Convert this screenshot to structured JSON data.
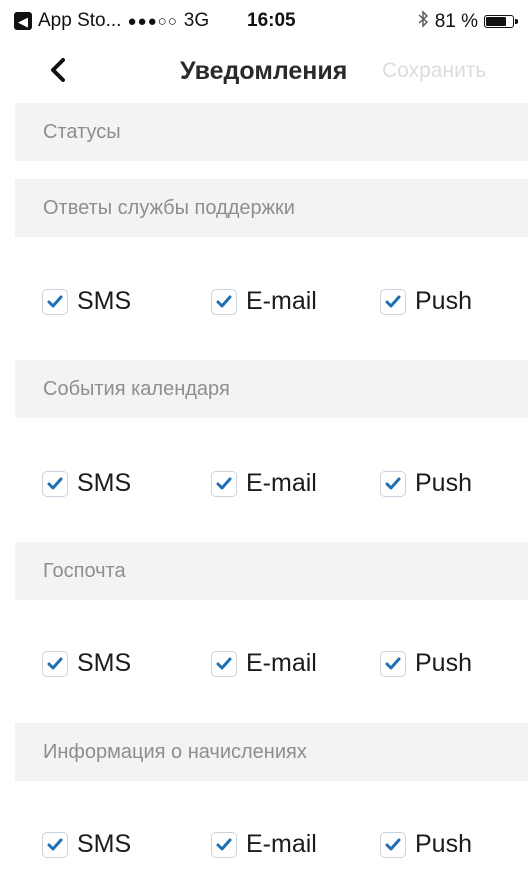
{
  "status_bar": {
    "back_app": "App Sto...",
    "signal": "●●●○○",
    "network": "3G",
    "time": "16:05",
    "battery_text": "81 %",
    "battery_level": 0.81
  },
  "navbar": {
    "title": "Уведомления",
    "save_label": "Сохранить"
  },
  "sections": [
    {
      "header": "Статусы"
    },
    {
      "header": "Ответы службы поддержки",
      "options": [
        {
          "label": "SMS",
          "checked": true
        },
        {
          "label": "E-mail",
          "checked": true
        },
        {
          "label": "Push",
          "checked": true
        }
      ]
    },
    {
      "header": "События календаря",
      "options": [
        {
          "label": "SMS",
          "checked": true
        },
        {
          "label": "E-mail",
          "checked": true
        },
        {
          "label": "Push",
          "checked": true
        }
      ]
    },
    {
      "header": "Госпочта",
      "options": [
        {
          "label": "SMS",
          "checked": true
        },
        {
          "label": "E-mail",
          "checked": true
        },
        {
          "label": "Push",
          "checked": true
        }
      ]
    },
    {
      "header": "Информация о начислениях",
      "options": [
        {
          "label": "SMS",
          "checked": true
        },
        {
          "label": "E-mail",
          "checked": true
        },
        {
          "label": "Push",
          "checked": true
        }
      ]
    }
  ],
  "colors": {
    "check": "#1e6fb4",
    "section_bg": "#f3f3f3",
    "section_text": "#8e8e8e",
    "save_disabled": "#dcdcdc"
  }
}
